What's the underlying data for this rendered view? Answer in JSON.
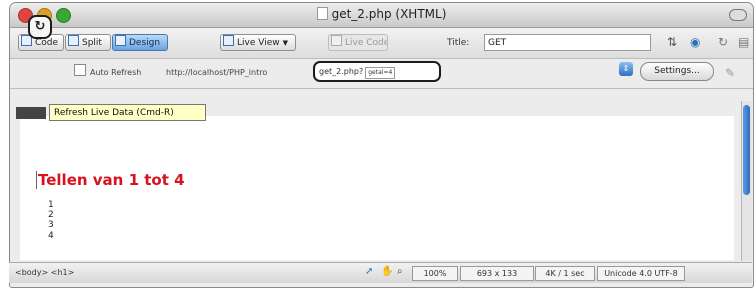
{
  "window": {
    "title": "get_2.php (XHTML)",
    "traffic_lights": {
      "close": "#e0443e",
      "minimize": "#dea123",
      "zoom": "#3aa732"
    }
  },
  "toolbar": {
    "code_label": "Code",
    "split_label": "Split",
    "design_label": "Design",
    "live_view_label": "Live View",
    "live_code_label": "Live Code",
    "title_label": "Title:",
    "title_value": "GET"
  },
  "live_bar": {
    "auto_refresh_label": "Auto Refresh",
    "url_prefix": "http://localhost/PHP_intro",
    "url_file": "get_2.php?",
    "url_param": "getal=4",
    "settings_label": "Settings..."
  },
  "tooltip": {
    "text": "Refresh Live Data (Cmd-R)"
  },
  "content": {
    "heading": "Tellen van 1 tot 4",
    "numbers": [
      "1",
      "2",
      "3",
      "4"
    ],
    "heading_color": "#d8121f"
  },
  "statusbar": {
    "tags": "<body> <h1>",
    "zoom": "100%",
    "size": "693 x 133",
    "download": "4K / 1 sec",
    "encoding": "Unicode 4.0 UTF-8"
  }
}
